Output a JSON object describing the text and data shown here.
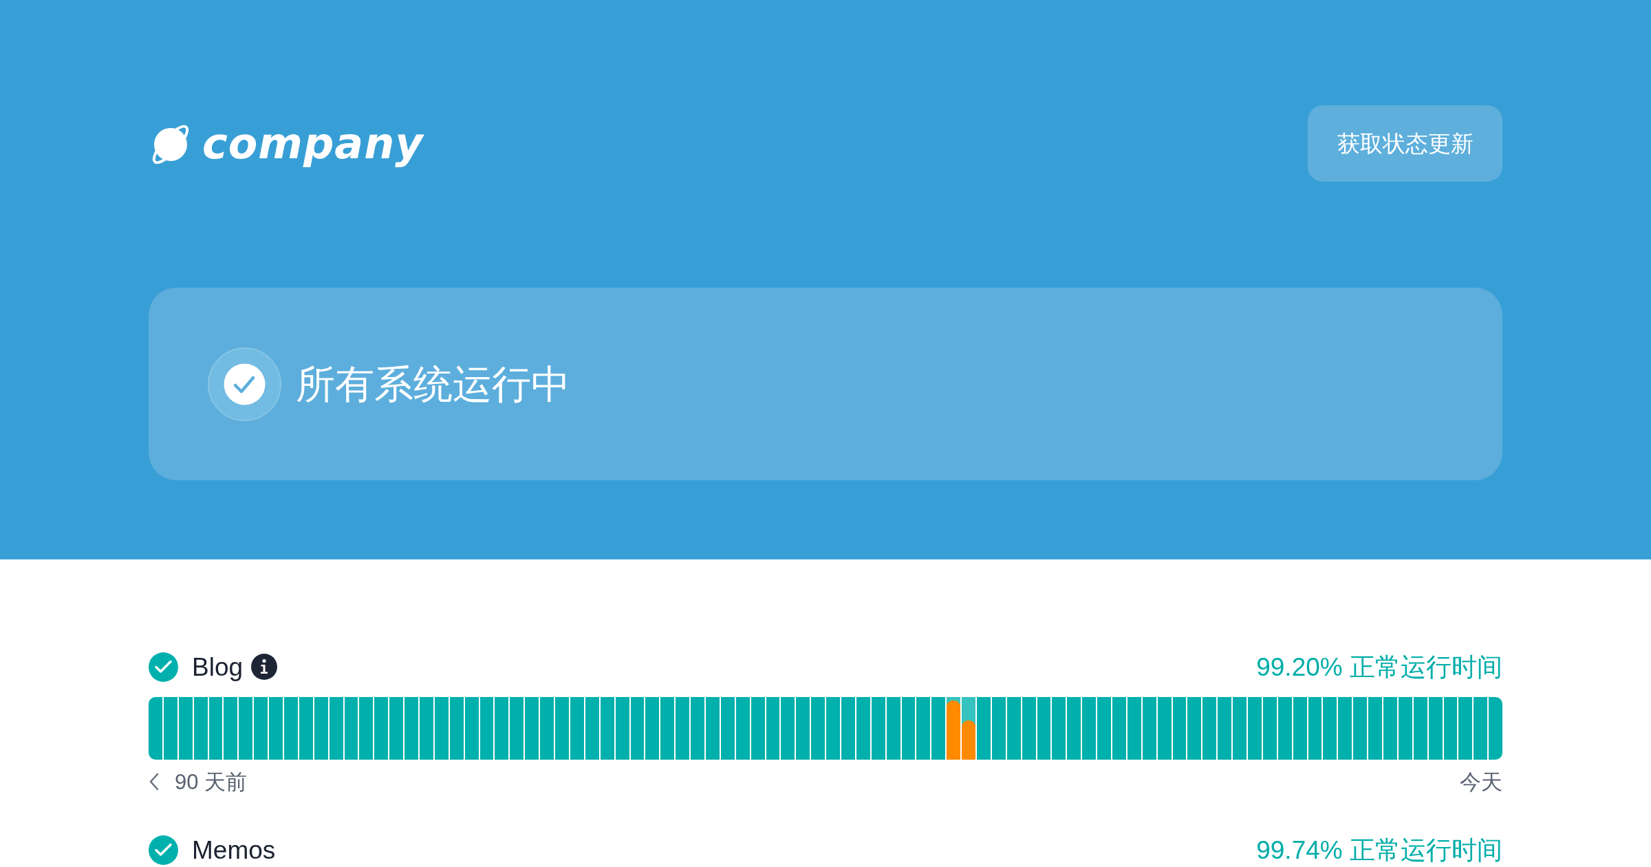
{
  "header": {
    "logo": {
      "text": "company"
    },
    "subscribe_button": "获取状态更新"
  },
  "status_banner": {
    "text": "所有系统运行中"
  },
  "components": [
    {
      "name": "Blog",
      "color": "#00b0ac",
      "info": true,
      "uptime": "99.20% 正常运行时间",
      "days": [
        {
          "kind": "up"
        },
        {
          "kind": "up"
        },
        {
          "kind": "up"
        },
        {
          "kind": "up"
        },
        {
          "kind": "up"
        },
        {
          "kind": "up"
        },
        {
          "kind": "up"
        },
        {
          "kind": "up"
        },
        {
          "kind": "up"
        },
        {
          "kind": "up"
        },
        {
          "kind": "up"
        },
        {
          "kind": "up"
        },
        {
          "kind": "up"
        },
        {
          "kind": "up"
        },
        {
          "kind": "up"
        },
        {
          "kind": "up"
        },
        {
          "kind": "up"
        },
        {
          "kind": "up"
        },
        {
          "kind": "up"
        },
        {
          "kind": "up"
        },
        {
          "kind": "up"
        },
        {
          "kind": "up"
        },
        {
          "kind": "up"
        },
        {
          "kind": "up"
        },
        {
          "kind": "up"
        },
        {
          "kind": "up"
        },
        {
          "kind": "up"
        },
        {
          "kind": "up"
        },
        {
          "kind": "up"
        },
        {
          "kind": "up"
        },
        {
          "kind": "up"
        },
        {
          "kind": "up"
        },
        {
          "kind": "up"
        },
        {
          "kind": "up"
        },
        {
          "kind": "up"
        },
        {
          "kind": "up"
        },
        {
          "kind": "up"
        },
        {
          "kind": "up"
        },
        {
          "kind": "up"
        },
        {
          "kind": "up"
        },
        {
          "kind": "up"
        },
        {
          "kind": "up"
        },
        {
          "kind": "up"
        },
        {
          "kind": "up"
        },
        {
          "kind": "up"
        },
        {
          "kind": "up"
        },
        {
          "kind": "up"
        },
        {
          "kind": "up"
        },
        {
          "kind": "up"
        },
        {
          "kind": "up"
        },
        {
          "kind": "up"
        },
        {
          "kind": "up"
        },
        {
          "kind": "up"
        },
        {
          "kind": "incident",
          "level": 0.94
        },
        {
          "kind": "incident",
          "level": 0.63
        },
        {
          "kind": "up"
        },
        {
          "kind": "up"
        },
        {
          "kind": "up"
        },
        {
          "kind": "up"
        },
        {
          "kind": "up"
        },
        {
          "kind": "up"
        },
        {
          "kind": "up"
        },
        {
          "kind": "up"
        },
        {
          "kind": "up"
        },
        {
          "kind": "up"
        },
        {
          "kind": "up"
        },
        {
          "kind": "up"
        },
        {
          "kind": "up"
        },
        {
          "kind": "up"
        },
        {
          "kind": "up"
        },
        {
          "kind": "up"
        },
        {
          "kind": "up"
        },
        {
          "kind": "up"
        },
        {
          "kind": "up"
        },
        {
          "kind": "up"
        },
        {
          "kind": "up"
        },
        {
          "kind": "up"
        },
        {
          "kind": "up"
        },
        {
          "kind": "up"
        },
        {
          "kind": "up"
        },
        {
          "kind": "up"
        },
        {
          "kind": "up"
        },
        {
          "kind": "up"
        },
        {
          "kind": "up"
        },
        {
          "kind": "up"
        },
        {
          "kind": "up"
        },
        {
          "kind": "up"
        },
        {
          "kind": "up"
        },
        {
          "kind": "up"
        },
        {
          "kind": "up"
        }
      ],
      "range_start": "90 天前",
      "range_end": "今天"
    },
    {
      "name": "Memos",
      "color": "#00b0ac",
      "uptime": "99.74% 正常运行时间"
    }
  ]
}
